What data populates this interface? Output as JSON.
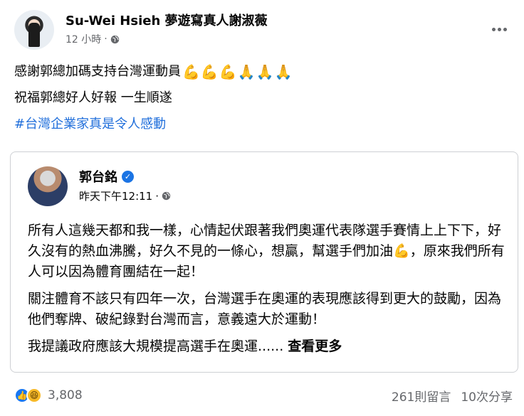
{
  "post": {
    "author": "Su-Wei Hsieh 夢遊寫真人謝淑薇",
    "time": "12 小時",
    "separator": "·",
    "lines": [
      "感謝郭總加碼支持台灣運動員",
      "祝福郭總好人好報 一生順遂"
    ],
    "hashtag": "#台灣企業家真是令人感動",
    "emojis": [
      "flexed-biceps",
      "flexed-biceps",
      "flexed-biceps",
      "folded-hands",
      "folded-hands",
      "folded-hands"
    ]
  },
  "shared_post": {
    "author": "郭台銘",
    "time": "昨天下午12:11",
    "separator": "·",
    "paragraph1_a": "所有人這幾天都和我一樣，心情起伏跟著我們奧運代表隊選手賽情上上下下，好久沒有的熱血沸騰，好久不見的一條心，想贏，幫選手們加油",
    "paragraph1_b": "，原來我們所有人可以因為體育團結在一起！",
    "paragraph2": "關注體育不該只有四年一次，台灣選手在奧運的表現應該得到更大的鼓勵，因為他們奪牌、破紀錄對台灣而言，意義遠大於運動！",
    "paragraph3": "我提議政府應該大規模提高選手在奧運......",
    "see_more": "查看更多"
  },
  "footer": {
    "reaction_count": "3,808",
    "comments": "261則留言",
    "shares": "10次分享"
  },
  "colors": {
    "hashtag": "#216fdb",
    "like": "#1877f2",
    "verified": "#1b74e4",
    "meta": "#65676b"
  }
}
